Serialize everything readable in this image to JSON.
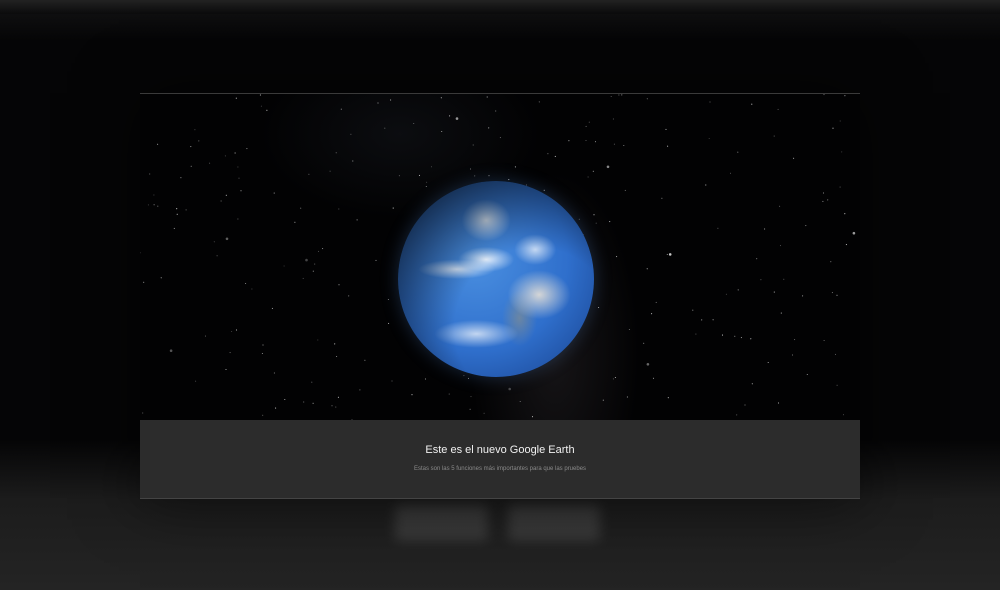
{
  "dialog": {
    "title": "Este es el nuevo Google Earth",
    "subtitle": "Estas son las 5 funciones más importantes para que las pruebes"
  },
  "colors": {
    "footer_bg": "#2c2c2c",
    "space_bg": "#020203",
    "ocean": "#2f6fcc"
  }
}
